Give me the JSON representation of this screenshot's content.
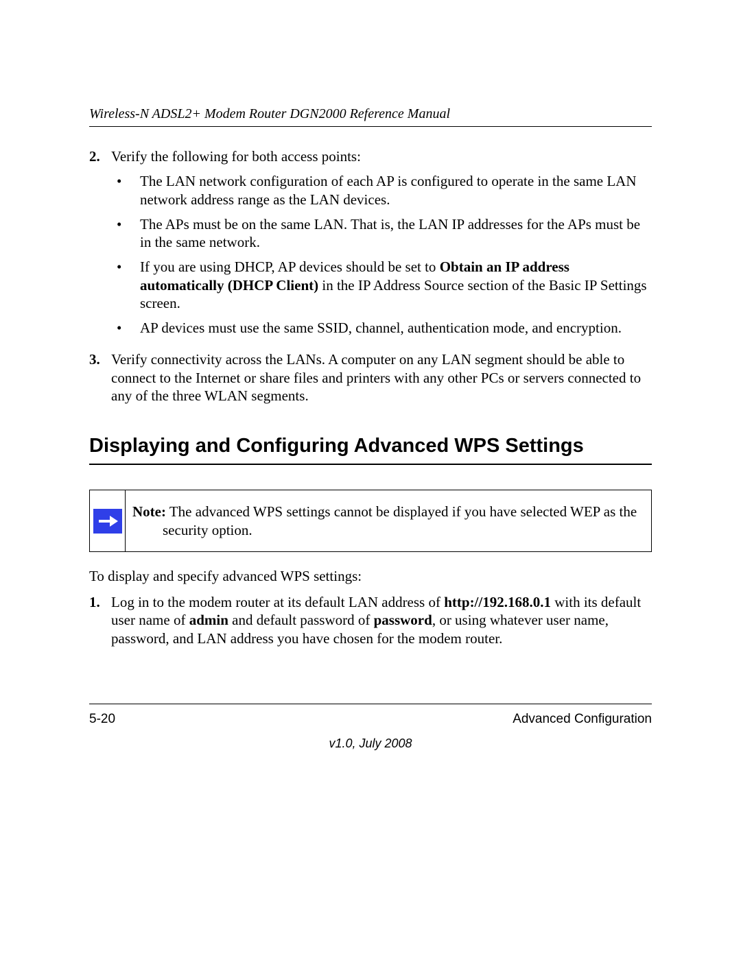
{
  "header": {
    "running_title": "Wireless-N ADSL2+ Modem Router DGN2000 Reference Manual"
  },
  "body": {
    "step2": {
      "num": "2.",
      "intro": "Verify the following for both access points:",
      "bullets": {
        "b1": "The LAN network configuration of each AP is configured to operate in the same LAN network address range as the LAN devices.",
        "b2": "The APs must be on the same LAN. That is, the LAN IP addresses for the APs must be in the same network.",
        "b3_pre": "If you are using DHCP, AP devices should be set to ",
        "b3_bold": "Obtain an IP address automatically (DHCP Client)",
        "b3_post": " in the IP Address Source section of the Basic IP Settings screen.",
        "b4": "AP devices must use the same SSID, channel, authentication mode, and encryption."
      }
    },
    "step3": {
      "num": "3.",
      "text": "Verify connectivity across the LANs. A computer on any LAN segment should be able to connect to the Internet or share files and printers with any other PCs or servers connected to any of the three WLAN segments."
    },
    "section_heading": "Displaying and Configuring Advanced WPS Settings",
    "note": {
      "label": "Note:",
      "text": " The advanced WPS settings cannot be displayed if you have selected WEP as the security option."
    },
    "after_note": "To display and specify advanced WPS settings:",
    "step1b": {
      "num": "1.",
      "pre": "Log in to the modem router at its default LAN address of ",
      "bold1": "http://192.168.0.1",
      "mid1": " with its default user name of ",
      "bold2": "admin",
      "mid2": " and default password of ",
      "bold3": "password",
      "post": ", or using whatever user name, password, and LAN address you have chosen for the modem router."
    }
  },
  "footer": {
    "page_num": "5-20",
    "section": "Advanced Configuration",
    "version": "v1.0, July 2008"
  }
}
